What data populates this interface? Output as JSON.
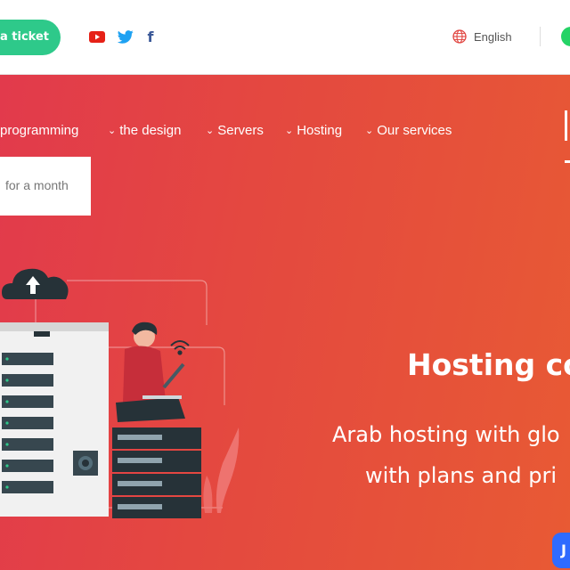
{
  "topbar": {
    "ticket_label": "a ticket",
    "social": [
      "youtube-icon",
      "twitter-icon",
      "facebook-icon"
    ],
    "facebook_glyph": "f",
    "language_label": "English"
  },
  "nav": {
    "items": [
      {
        "label": "programming",
        "has_chevron": false
      },
      {
        "label": "the design",
        "has_chevron": true
      },
      {
        "label": "Servers",
        "has_chevron": true
      },
      {
        "label": "Hosting",
        "has_chevron": true
      },
      {
        "label": "Our services",
        "has_chevron": true
      }
    ],
    "chevron": "⌄"
  },
  "search": {
    "text": "for a month"
  },
  "hero": {
    "title": "Hosting co",
    "subtitle_line1": "Arab hosting with glo",
    "subtitle_line2": "with plans and pri"
  },
  "chat": {
    "label": "J"
  },
  "colors": {
    "accent_green": "#2ec98a",
    "hero_start": "#e23a4c",
    "hero_end": "#e85a34",
    "whatsapp": "#25d366",
    "chat_blue": "#2f6bff"
  }
}
